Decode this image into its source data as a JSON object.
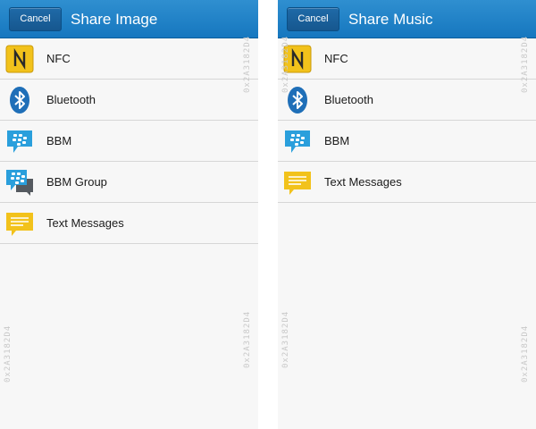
{
  "screens": [
    {
      "cancel_label": "Cancel",
      "title": "Share Image",
      "items": [
        {
          "label": "NFC",
          "icon": "nfc-icon"
        },
        {
          "label": "Bluetooth",
          "icon": "bluetooth-icon"
        },
        {
          "label": "BBM",
          "icon": "bbm-icon"
        },
        {
          "label": "BBM Group",
          "icon": "bbm-group-icon"
        },
        {
          "label": "Text Messages",
          "icon": "text-messages-icon"
        }
      ],
      "watermark": "0x2A3182D4"
    },
    {
      "cancel_label": "Cancel",
      "title": "Share Music",
      "items": [
        {
          "label": "NFC",
          "icon": "nfc-icon"
        },
        {
          "label": "Bluetooth",
          "icon": "bluetooth-icon"
        },
        {
          "label": "BBM",
          "icon": "bbm-icon"
        },
        {
          "label": "Text Messages",
          "icon": "text-messages-icon"
        }
      ],
      "watermark": "0x2A3182D4"
    }
  ],
  "colors": {
    "titlebar": "#1a7cc4",
    "background": "#f7f7f7",
    "divider": "#d6d6d6",
    "nfc": "#f2c21b",
    "bluetooth": "#1f6fb8",
    "bbm": "#2a9fdc",
    "text_messages": "#f2c21b"
  }
}
